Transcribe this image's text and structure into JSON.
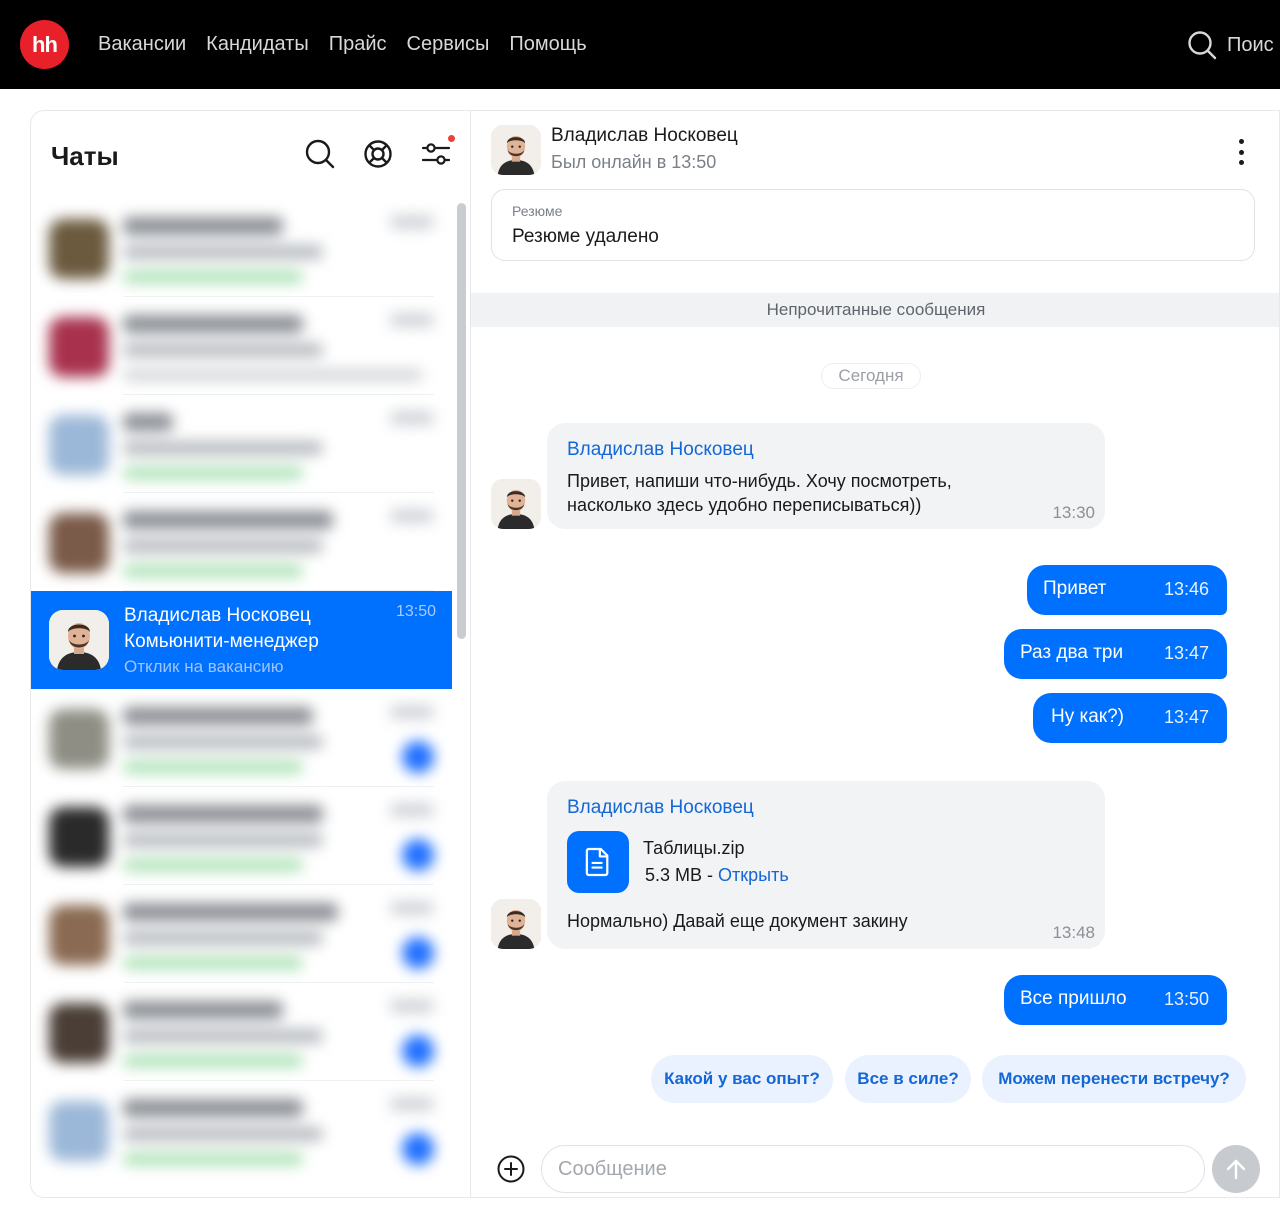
{
  "topbar": {
    "logo": "hh",
    "nav": [
      "Вакансии",
      "Кандидаты",
      "Прайс",
      "Сервисы",
      "Помощь"
    ],
    "search_label": "Поис"
  },
  "chats": {
    "title": "Чаты",
    "active": {
      "name": "Владислав Носковец",
      "role": "Комьюнити-менеджер",
      "subtitle": "Отклик на вакансию",
      "time": "13:50"
    }
  },
  "conversation": {
    "name": "Владислав Носковец",
    "status": "Был онлайн в 13:50",
    "resume_label": "Резюме",
    "resume_value": "Резюме удалено",
    "unread_label": "Непрочитанные сообщения",
    "date_label": "Сегодня",
    "messages": [
      {
        "author": "Владислав Носковец",
        "line1": "Привет, напиши что-нибудь. Хочу посмотреть,",
        "line2": "насколько здесь удобно переписываться))",
        "time": "13:30"
      },
      {
        "text": "Привет",
        "time": "13:46"
      },
      {
        "text": "Раз два три",
        "time": "13:47"
      },
      {
        "text": "Ну как?)",
        "time": "13:47"
      },
      {
        "author": "Владислав Носковец",
        "file_name": "Таблицы.zip",
        "file_size": "5.3 MB - ",
        "file_action": "Открыть",
        "text": "Нормально) Давай еще документ закину",
        "time": "13:48"
      },
      {
        "text": "Все пришло",
        "time": "13:50"
      }
    ],
    "quick_replies": [
      "Какой у вас опыт?",
      "Все в силе?",
      "Можем перенести встречу?"
    ],
    "input_placeholder": "Сообщение"
  },
  "colors": {
    "accent": "#0070ff",
    "brand_red": "#e8202a",
    "link": "#1367d6"
  }
}
